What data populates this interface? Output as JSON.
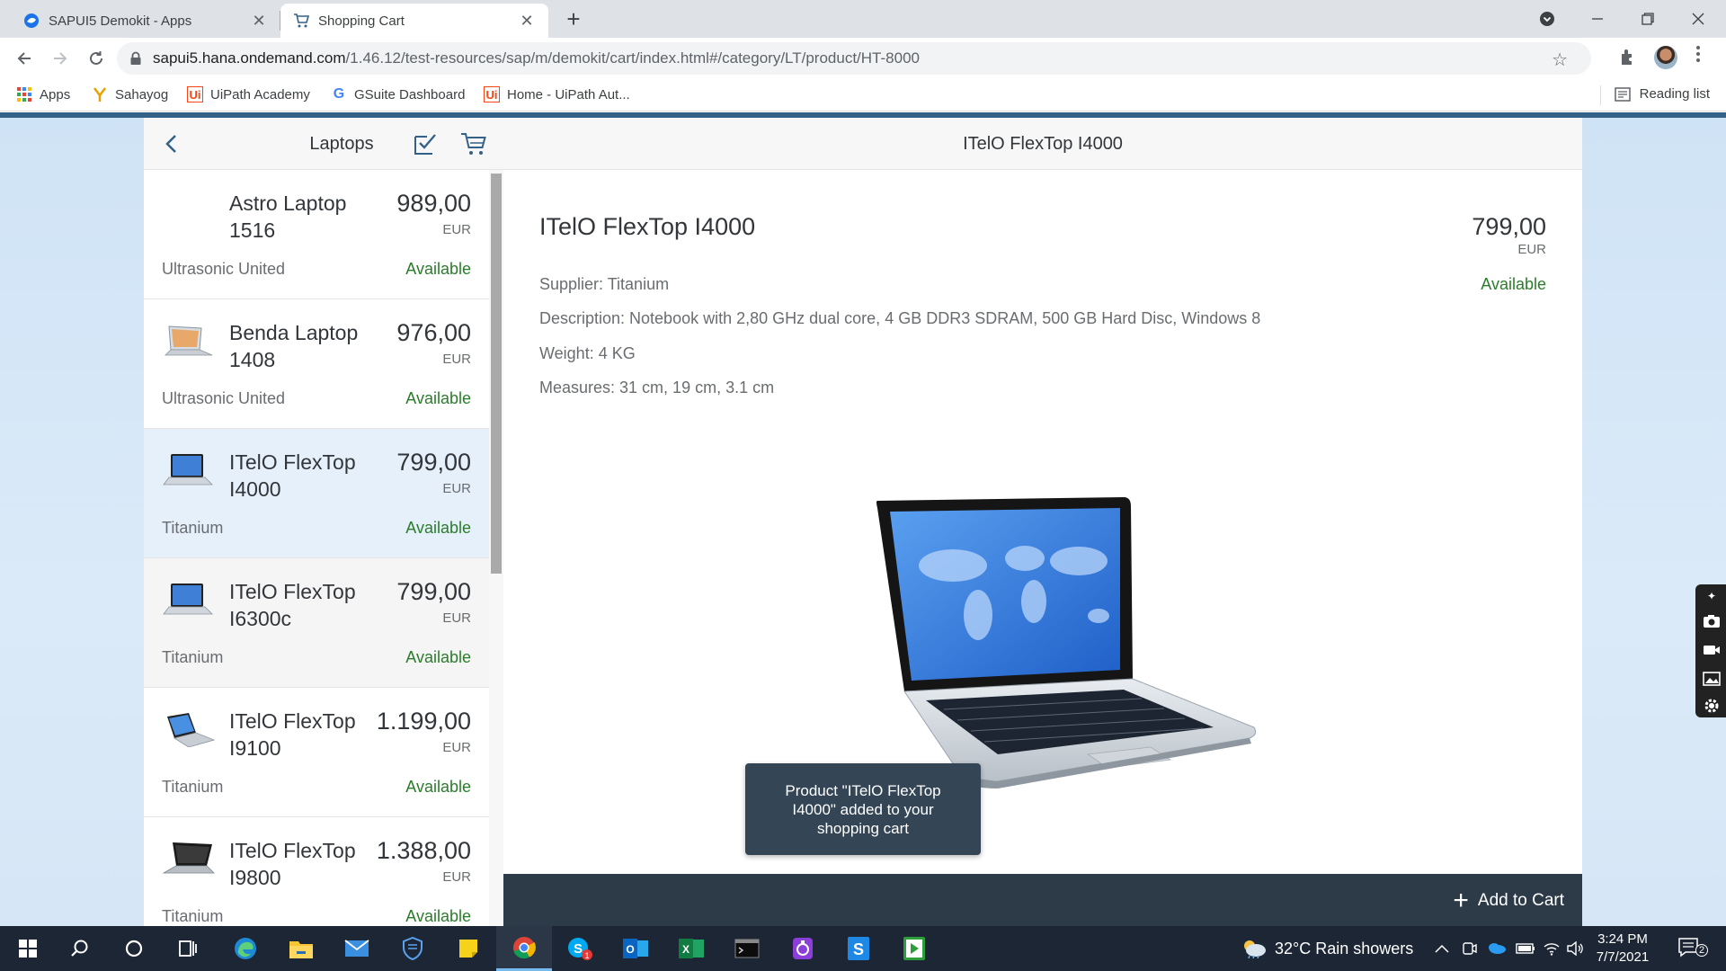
{
  "browser": {
    "tabs": [
      {
        "title": "SAPUI5 Demokit - Apps",
        "active": false
      },
      {
        "title": "Shopping Cart",
        "active": true
      }
    ],
    "address": {
      "host": "sapui5.hana.ondemand.com",
      "path": "/1.46.12/test-resources/sap/m/demokit/cart/index.html#/category/LT/product/HT-8000"
    },
    "bookmarks": [
      "Apps",
      "Sahayog",
      "UiPath Academy",
      "GSuite Dashboard",
      "Home - UiPath Aut..."
    ],
    "reading_list": "Reading list"
  },
  "master": {
    "title": "Laptops",
    "items": [
      {
        "name": "Astro Laptop 1516",
        "price": "989,00",
        "currency": "EUR",
        "supplier": "Ultrasonic United",
        "status": "Available",
        "state": "normal",
        "thumb": "none"
      },
      {
        "name": "Benda Laptop 1408",
        "price": "976,00",
        "currency": "EUR",
        "supplier": "Ultrasonic United",
        "status": "Available",
        "state": "normal",
        "thumb": "laptop-open"
      },
      {
        "name": "ITelO FlexTop I4000",
        "price": "799,00",
        "currency": "EUR",
        "supplier": "Titanium",
        "status": "Available",
        "state": "selected",
        "thumb": "laptop-blue"
      },
      {
        "name": "ITelO FlexTop I6300c",
        "price": "799,00",
        "currency": "EUR",
        "supplier": "Titanium",
        "status": "Available",
        "state": "hovered",
        "thumb": "laptop-blue"
      },
      {
        "name": "ITelO FlexTop I9100",
        "price": "1.199,00",
        "currency": "EUR",
        "supplier": "Titanium",
        "status": "Available",
        "state": "normal",
        "thumb": "laptop-side"
      },
      {
        "name": "ITelO FlexTop I9800",
        "price": "1.388,00",
        "currency": "EUR",
        "supplier": "Titanium",
        "status": "Available",
        "state": "normal",
        "thumb": "laptop-dark"
      }
    ]
  },
  "detail": {
    "header_title": "ITelO FlexTop I4000",
    "title": "ITelO FlexTop I4000",
    "price": "799,00",
    "currency": "EUR",
    "status": "Available",
    "supplier": "Supplier: Titanium",
    "description": "Description: Notebook with 2,80 GHz dual core, 4 GB DDR3 SDRAM, 500 GB Hard Disc, Windows 8",
    "weight": "Weight: 4 KG",
    "measures": "Measures: 31 cm, 19 cm, 3.1 cm",
    "add_to_cart": "Add to Cart"
  },
  "toast": "Product \"ITelO FlexTop I4000\" added to your shopping cart",
  "taskbar": {
    "weather": "32°C  Rain showers",
    "time": "3:24 PM",
    "date": "7/7/2021",
    "notification_count": "2"
  },
  "colors": {
    "status_available": "#2b7c2b",
    "shell_blue": "#346187",
    "footer": "#2d3a48",
    "selected_row": "#e5f0fa"
  }
}
